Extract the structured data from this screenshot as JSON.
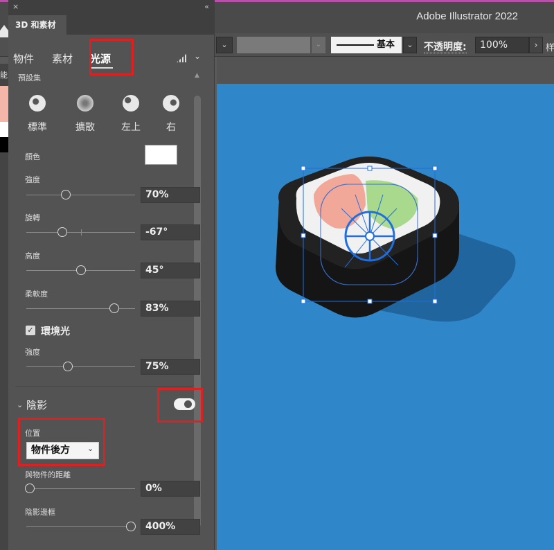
{
  "app": {
    "title": "Adobe Illustrator 2022"
  },
  "control_bar": {
    "stroke_style": "基本",
    "opacity_label": "不透明度:",
    "opacity_value": "100%",
    "dropdown_glyph": "⌄",
    "more_glyph": "样"
  },
  "panel": {
    "tab_title": "3D 和素材",
    "close_glyph": "×",
    "collapse_glyph": "«",
    "subtabs": {
      "object": "物件",
      "material": "素材",
      "light": "光源"
    },
    "active_subtab": "light",
    "left_strip_label": "能",
    "presets": {
      "label": "預設集",
      "items": [
        {
          "label": "標準",
          "icon": "light-standard-icon"
        },
        {
          "label": "擴散",
          "icon": "light-diffuse-icon"
        },
        {
          "label": "左上",
          "icon": "light-top-left-icon"
        },
        {
          "label": "右",
          "icon": "light-right-icon"
        }
      ]
    },
    "color": {
      "label": "顏色",
      "value": "#ffffff"
    },
    "intensity": {
      "label": "強度",
      "value": "70%"
    },
    "rotation": {
      "label": "旋轉",
      "value": "-67°"
    },
    "height": {
      "label": "高度",
      "value": "45°"
    },
    "softness": {
      "label": "柔軟度",
      "value": "83%"
    },
    "ambient": {
      "label": "環境光",
      "checked": true,
      "intensity_label": "強度",
      "intensity_value": "75%"
    },
    "shadow": {
      "label": "陰影",
      "enabled": true,
      "position_label": "位置",
      "position_value": "物件後方",
      "distance_label": "與物件的距離",
      "distance_value": "0%",
      "bounds_label": "陰影邊框",
      "bounds_value": "400%"
    }
  },
  "colors": {
    "artboard": "#2f86c8",
    "panel": "#535353",
    "highlight": "#e02020",
    "selection": "#1f6fe0"
  }
}
